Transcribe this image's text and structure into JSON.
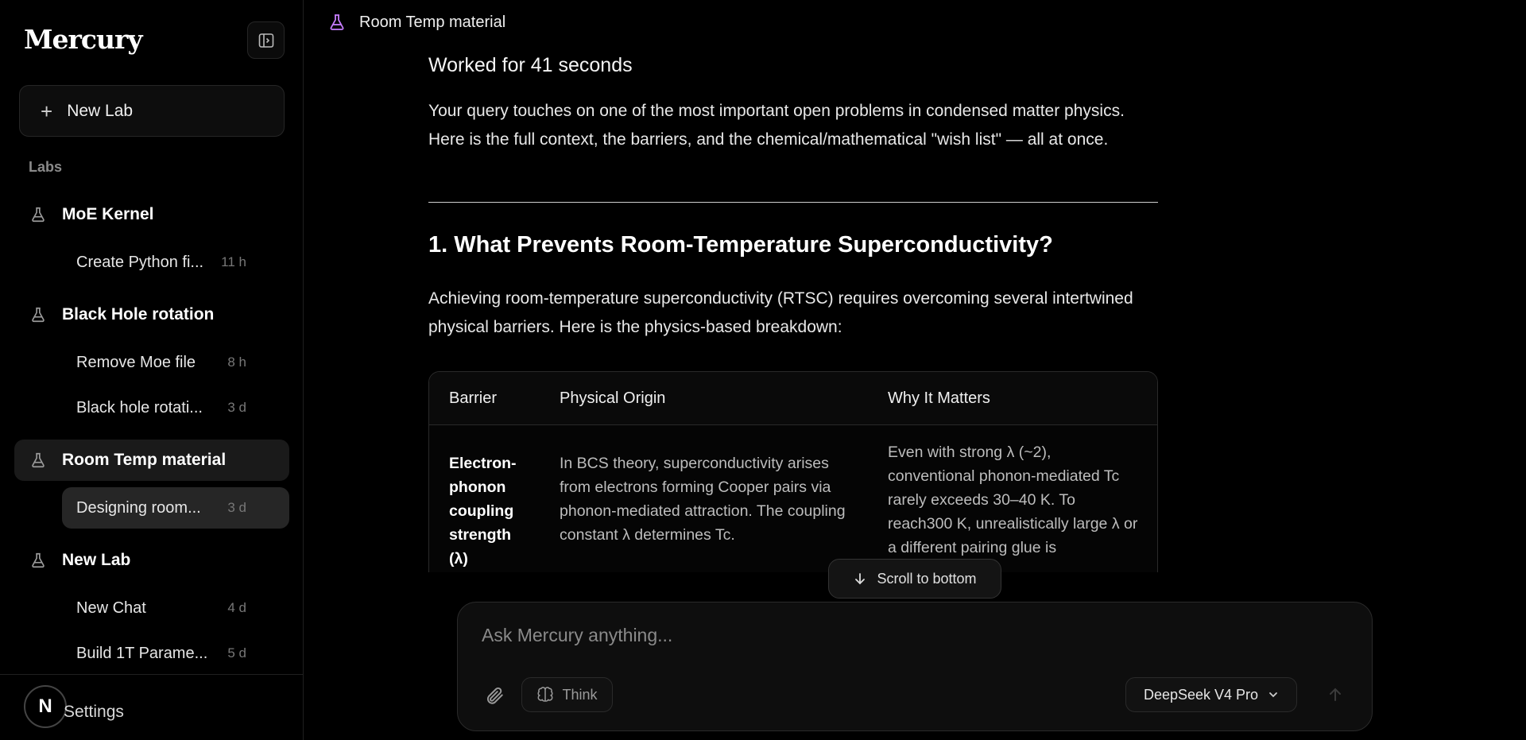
{
  "app": {
    "brand": "Mercury"
  },
  "sidebar": {
    "new_lab_label": "New Lab",
    "section_label": "Labs",
    "labs": [
      {
        "name": "MoE Kernel",
        "chats": [
          {
            "name": "Create Python fi...",
            "time": "11 h"
          }
        ]
      },
      {
        "name": "Black Hole rotation",
        "chats": [
          {
            "name": "Remove Moe file",
            "time": "8 h"
          },
          {
            "name": "Black hole rotati...",
            "time": "3 d"
          }
        ]
      },
      {
        "name": "Room Temp material",
        "chats": [
          {
            "name": "Designing room...",
            "time": "3 d"
          }
        ]
      },
      {
        "name": "New Lab",
        "chats": [
          {
            "name": "New Chat",
            "time": "4 d"
          },
          {
            "name": "Build 1T Parame...",
            "time": "5 d"
          }
        ]
      }
    ],
    "avatar_initial": "N",
    "settings_label": "Settings"
  },
  "header": {
    "title": "Room Temp material"
  },
  "message": {
    "worked": "Worked for 41 seconds",
    "intro": "Your query touches on one of the most important open problems in condensed matter physics. Here is the full context, the barriers, and the chemical/mathematical \"wish list\" — all at once.",
    "heading": "1. What Prevents Room-Temperature Superconductivity?",
    "paragraph": "Achieving room-temperature superconductivity (RTSC) requires overcoming several intertwined physical barriers. Here is the physics-based breakdown:",
    "table": {
      "headers": [
        "Barrier",
        "Physical Origin",
        "Why It Matters"
      ],
      "row": {
        "barrier": "Electron-phonon coupling strength (λ)",
        "origin": "In BCS theory, superconductivity arises from electrons forming Cooper pairs via phonon-mediated attraction. The coupling constant λ determines Tc.",
        "why": "Even with strong λ (~2), conventional phonon-mediated Tc rarely exceeds 30–40 K. To reach300 K, unrealistically large λ or a different pairing glue is"
      }
    }
  },
  "scroll_label": "Scroll to bottom",
  "composer": {
    "placeholder": "Ask Mercury anything...",
    "think_label": "Think",
    "model_label": "DeepSeek V4 Pro"
  },
  "colors": {
    "accent_flask_active": "#c77dff",
    "flask": "#9a9a9a"
  }
}
